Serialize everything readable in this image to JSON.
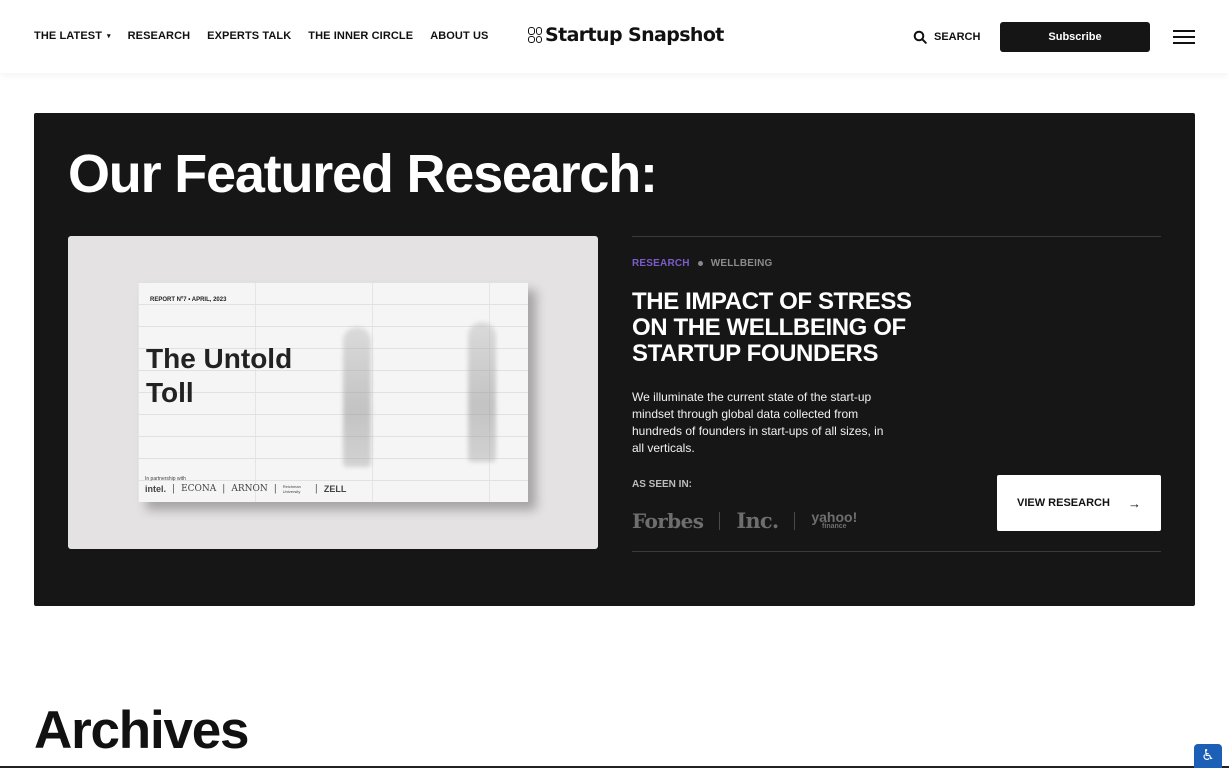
{
  "nav": {
    "items": [
      {
        "label": "THE LATEST",
        "caret": "▾"
      },
      {
        "label": "RESEARCH"
      },
      {
        "label": "EXPERTS TALK"
      },
      {
        "label": "THE INNER CIRCLE"
      },
      {
        "label": "ABOUT US"
      }
    ]
  },
  "logo": {
    "text": "Startup Snapshot"
  },
  "search": {
    "label": "SEARCH"
  },
  "subscribe": {
    "label": "Subscribe"
  },
  "featured": {
    "heading": "Our Featured Research:",
    "cover": {
      "meta": "REPORT Nº7 • APRIL, 2023",
      "title": "The Untold Toll",
      "partners_label": "In partnership with",
      "partners": [
        "intel.",
        "ECONA",
        "ARNON",
        "Reichman University",
        "ZELL"
      ]
    },
    "tags": {
      "primary": "RESEARCH",
      "secondary": "WELLBEING"
    },
    "headline": "THE IMPACT OF STRESS ON THE WELLBEING OF STARTUP FOUNDERS",
    "description": "We illuminate the current state of the start-up mindset through global data collected from hundreds of founders in start-ups of all sizes, in all verticals.",
    "seen_label": "AS SEEN IN:",
    "seen_in": {
      "forbes": "Forbes",
      "inc": "Inc.",
      "yahoo": "yahoo!",
      "yahoo_sub": "finance"
    },
    "cta": {
      "label": "VIEW RESEARCH",
      "arrow": "→"
    }
  },
  "archives": {
    "heading": "Archives"
  },
  "colors": {
    "accent": "#7b5cc9",
    "dark": "#161616"
  }
}
